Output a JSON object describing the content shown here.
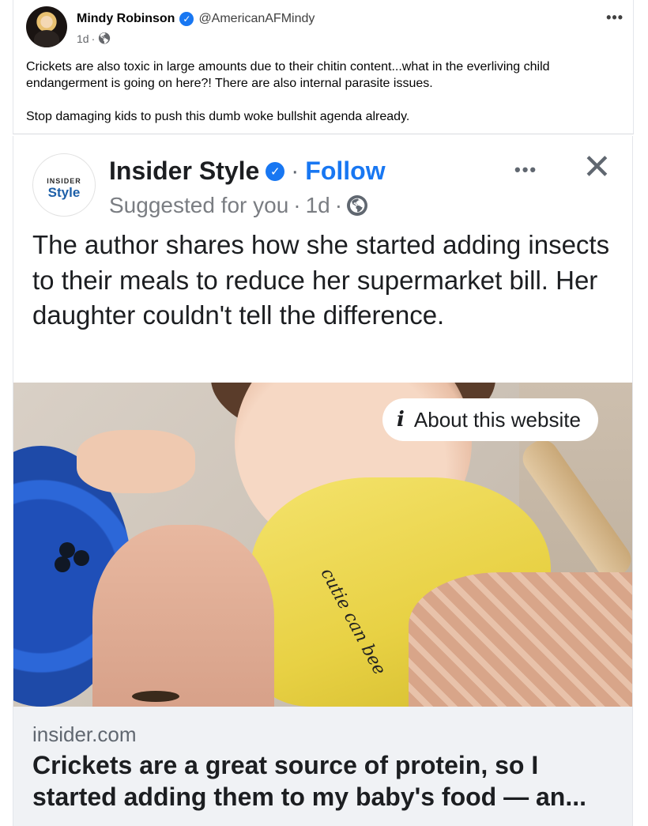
{
  "post": {
    "author_name": "Mindy Robinson",
    "handle": "@AmericanAFMindy",
    "timestamp": "1d",
    "separator": "·",
    "verified_icon": "verified-badge-icon",
    "privacy_icon": "globe-icon",
    "more_label": "•••",
    "text_paragraphs": [
      "Crickets are also toxic in large amounts due to their chitin content...what in the everliving child endangerment is going on here?! There are also internal parasite issues.",
      "Stop damaging kids to push this dumb woke bullshit agenda already."
    ]
  },
  "shared": {
    "logo_top": "INSIDER",
    "logo_bottom": "Style",
    "page_name": "Insider Style",
    "separator": "·",
    "follow_label": "Follow",
    "suggested_label": "Suggested for you",
    "timestamp": "1d",
    "more_label": "•••",
    "close_label": "✕",
    "caption": "The author shares how she started adding insects to their meals to reduce her supermarket bill. Her daughter couldn't tell the difference.",
    "image": {
      "about_label": "About this website",
      "about_icon": "i",
      "bib_text": "cutie can bee"
    },
    "link": {
      "domain": "insider.com",
      "title": "Crickets are a great source of protein, so I started adding them to my baby's food — an..."
    }
  },
  "colors": {
    "accent": "#1877f2",
    "text": "#050505",
    "muted": "#65676b",
    "footer_bg": "#f0f2f5",
    "bib_yellow": "#f4e36c",
    "bowl_blue": "#2c67d8"
  }
}
